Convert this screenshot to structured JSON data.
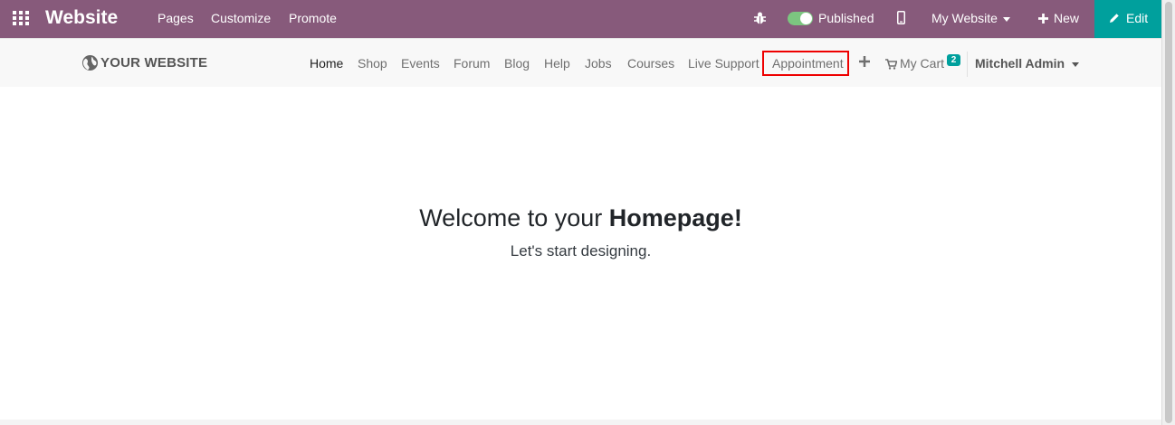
{
  "topbar": {
    "app_title": "Website",
    "menu": [
      "Pages",
      "Customize",
      "Promote"
    ],
    "published_label": "Published",
    "site_selector": "My Website",
    "new_label": "New",
    "edit_label": "Edit",
    "colors": {
      "background": "#875a7b",
      "edit": "#00a09d",
      "toggle": "#7cc680"
    }
  },
  "navbar": {
    "logo_text": "YOUR WEBSITE",
    "links": [
      "Home",
      "Shop",
      "Events",
      "Forum",
      "Blog",
      "Help",
      "Jobs",
      "Courses",
      "Live Support",
      "Appointment"
    ],
    "active_link": "Home",
    "highlighted_link": "Appointment",
    "cart_label": "My Cart",
    "cart_count": "2",
    "user_name": "Mitchell Admin"
  },
  "main": {
    "welcome_prefix": "Welcome to your",
    "welcome_strong": "Homepage!",
    "subtitle": "Let's start designing."
  },
  "icons": [
    "apps-grid-icon",
    "bug-icon",
    "mobile-icon",
    "plus-icon",
    "pencil-icon",
    "globe-icon",
    "cart-icon",
    "caret-down-icon"
  ]
}
